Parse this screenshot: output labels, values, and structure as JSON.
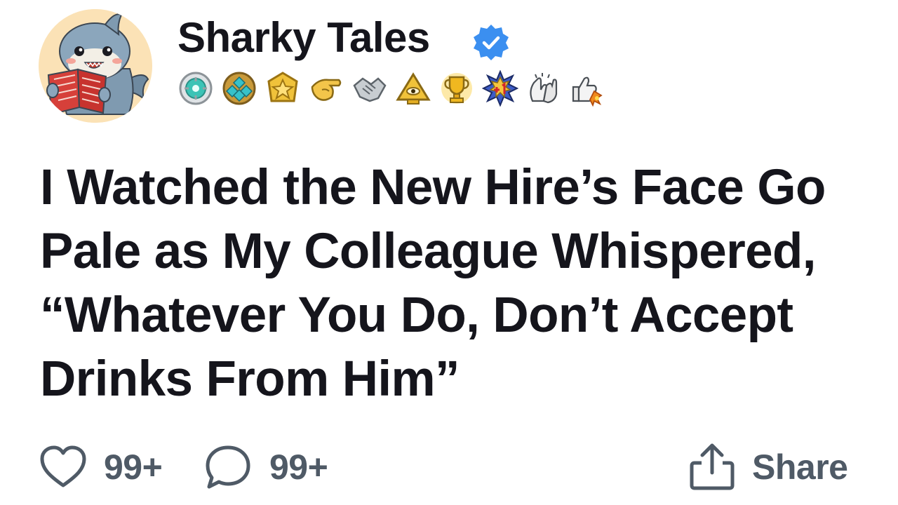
{
  "author": {
    "name": "Sharky Tales",
    "verified": true,
    "avatar_icon": "shark-reading-book-avatar",
    "verified_color": "#3b8ff0"
  },
  "badges": [
    "teal-gear-badge-icon",
    "teal-gem-cluster-badge-icon",
    "gold-star-badge-icon",
    "pointing-hand-badge-icon",
    "handshake-badge-icon",
    "pyramid-eye-badge-icon",
    "gold-trophy-badge-icon",
    "plus-one-burst-badge-icon",
    "clapping-hands-badge-icon",
    "thumbs-up-rocket-badge-icon"
  ],
  "post": {
    "headline": "I Watched the New Hire’s Face Go Pale as My Colleague Whispered, “Whatever You Do, Don’t Accept Drinks From Him”"
  },
  "actions": {
    "likes": "99+",
    "comments": "99+",
    "share_label": "Share",
    "icon_color": "#4f5a66"
  }
}
